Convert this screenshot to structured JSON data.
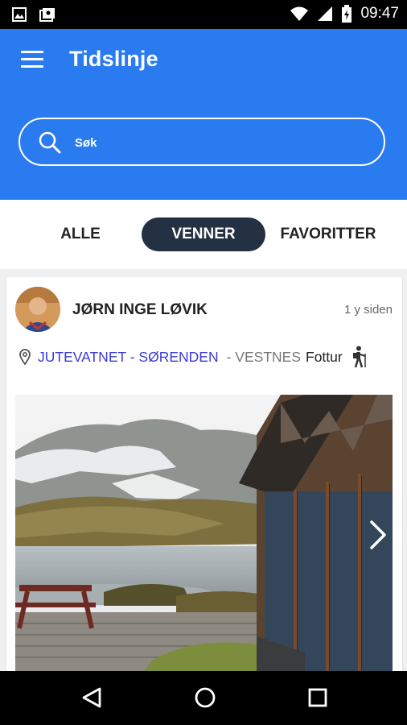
{
  "status_bar": {
    "time": "09:47",
    "icons": [
      "image-icon",
      "photo-album-icon",
      "wifi-icon",
      "signal-icon",
      "battery-charging-icon"
    ]
  },
  "app_bar": {
    "title": "Tidslinje",
    "search": {
      "placeholder": "Søk",
      "value": ""
    }
  },
  "tabs": [
    {
      "label": "ALLE",
      "active": false
    },
    {
      "label": "VENNER",
      "active": true
    },
    {
      "label": "FAVORITTER",
      "active": false
    }
  ],
  "feed": [
    {
      "user": "JØRN INGE LØVIK",
      "time_ago": "1 y siden",
      "location": "JUTEVATNET - SØRENDEN",
      "region": "- VESTNES",
      "activity": "Fottur",
      "activity_icon": "hiking-icon"
    }
  ],
  "colors": {
    "primary": "#2b7bf0",
    "active_tab": "#243142",
    "link": "#3b3bd6"
  }
}
